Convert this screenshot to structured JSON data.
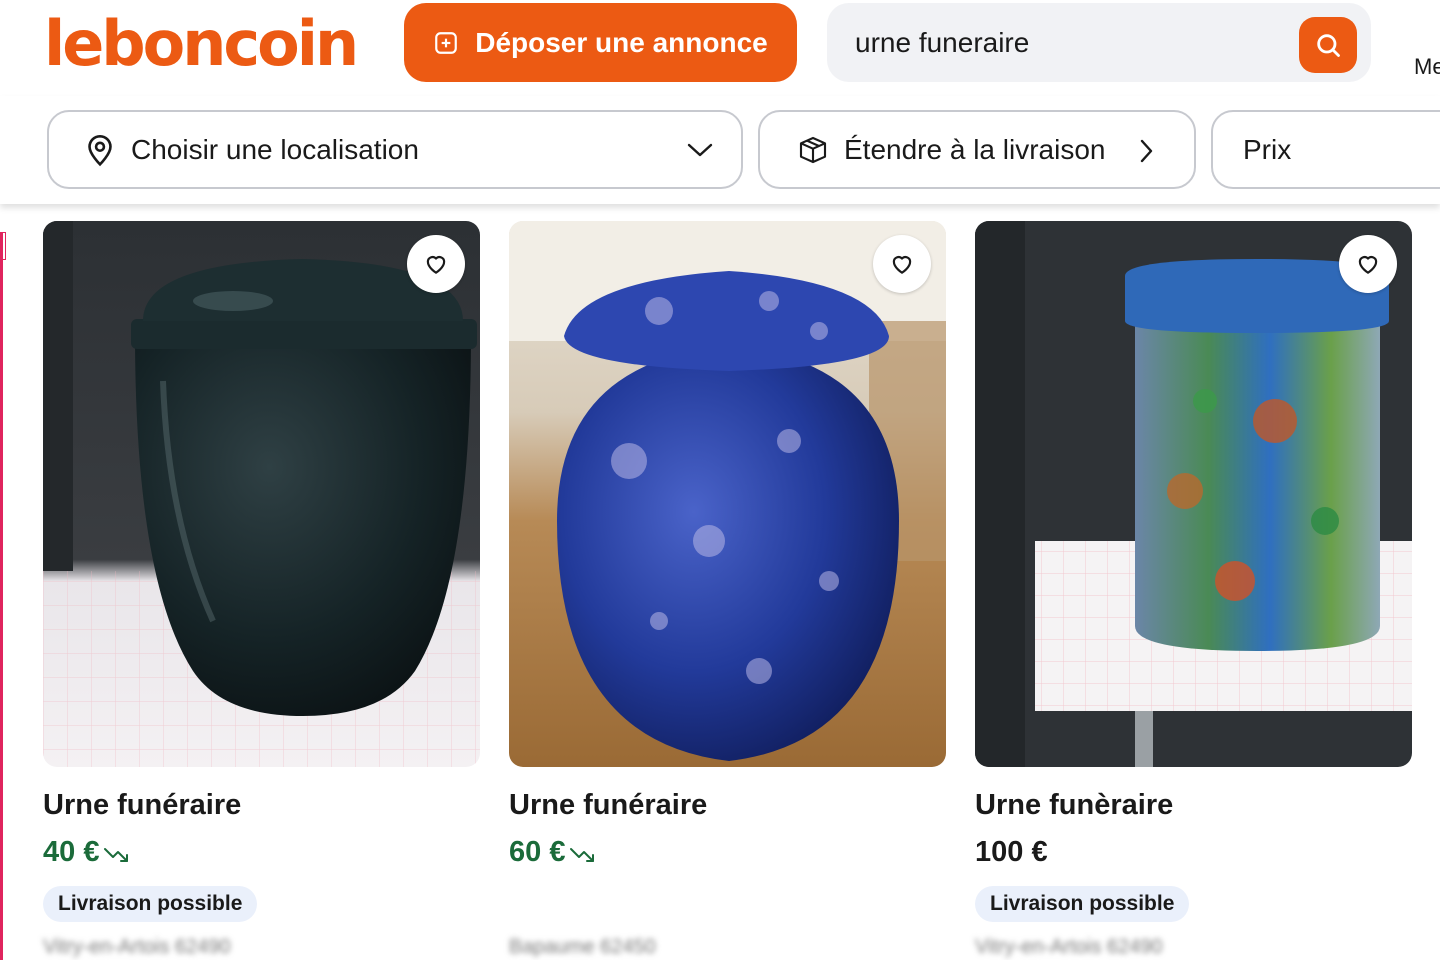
{
  "header": {
    "logo": "leboncoin",
    "post_button_label": "Déposer une annonce",
    "search_value": "urne funeraire",
    "menu_partial": "Me"
  },
  "filters": {
    "location_label": "Choisir une localisation",
    "delivery_label": "Étendre à la livraison",
    "price_label": "Prix"
  },
  "listings": [
    {
      "title": "Urne funéraire",
      "price": "40 €",
      "price_drop": true,
      "badge": "Livraison possible",
      "location": "Vitry-en-Artois 62490"
    },
    {
      "title": "Urne funéraire",
      "price": "60 €",
      "price_drop": true,
      "badge": "",
      "location": "Bapaume 62450"
    },
    {
      "title": "Urne funèraire",
      "price": "100 €",
      "price_drop": false,
      "badge": "Livraison possible",
      "location": "Vitry-en-Artois 62490"
    }
  ],
  "colors": {
    "brand": "#ec5a13",
    "price_drop": "#1b6b3a",
    "badge_bg": "#eaf0fb"
  }
}
